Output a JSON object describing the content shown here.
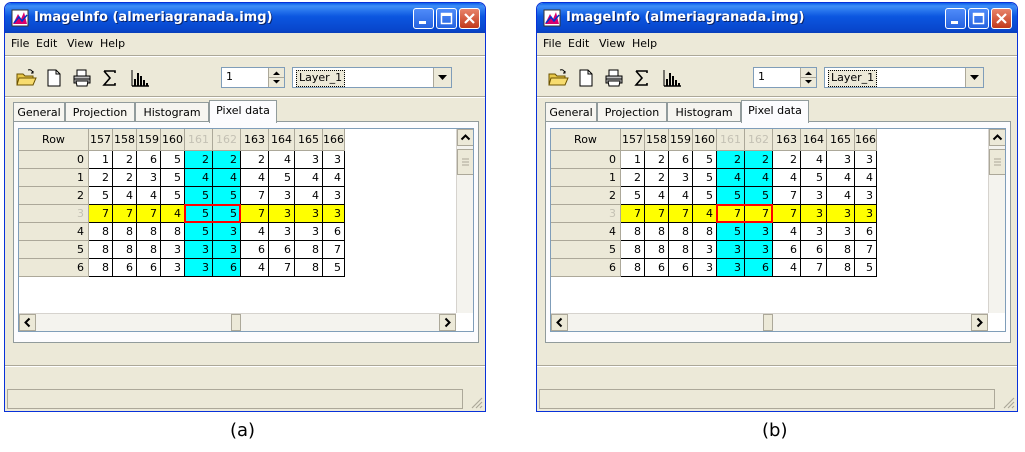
{
  "windows": [
    {
      "title": "ImageInfo (almeriagranada.img)",
      "menu": [
        "File",
        "Edit",
        "View",
        "Help"
      ],
      "spin_value": "1",
      "layer": "Layer_1",
      "tabs": [
        "General",
        "Projection",
        "Histogram",
        "Pixel data"
      ],
      "active_tab": "Pixel data",
      "grid": {
        "row_header": "Row",
        "columns": [
          "157",
          "158",
          "159",
          "160",
          "161",
          "162",
          "163",
          "164",
          "165",
          "166"
        ],
        "rows": [
          {
            "label": "0",
            "cells": [
              "1",
              "2",
              "6",
              "5",
              "2",
              "2",
              "2",
              "4",
              "3",
              "3"
            ]
          },
          {
            "label": "1",
            "cells": [
              "2",
              "2",
              "3",
              "5",
              "4",
              "4",
              "4",
              "5",
              "4",
              "4"
            ]
          },
          {
            "label": "2",
            "cells": [
              "5",
              "4",
              "4",
              "5",
              "5",
              "5",
              "7",
              "3",
              "4",
              "3"
            ]
          },
          {
            "label": "3",
            "cells": [
              "7",
              "7",
              "7",
              "4",
              "5",
              "5",
              "7",
              "3",
              "3",
              "3"
            ]
          },
          {
            "label": "4",
            "cells": [
              "8",
              "8",
              "8",
              "8",
              "5",
              "3",
              "4",
              "3",
              "3",
              "6"
            ]
          },
          {
            "label": "5",
            "cells": [
              "8",
              "8",
              "8",
              "3",
              "3",
              "3",
              "6",
              "6",
              "8",
              "7"
            ]
          },
          {
            "label": "6",
            "cells": [
              "8",
              "6",
              "6",
              "3",
              "3",
              "6",
              "4",
              "7",
              "8",
              "5"
            ]
          }
        ]
      }
    },
    {
      "title": "ImageInfo (almeriagranada.img)",
      "menu": [
        "File",
        "Edit",
        "View",
        "Help"
      ],
      "spin_value": "1",
      "layer": "Layer_1",
      "tabs": [
        "General",
        "Projection",
        "Histogram",
        "Pixel data"
      ],
      "active_tab": "Pixel data",
      "grid": {
        "row_header": "Row",
        "columns": [
          "157",
          "158",
          "159",
          "160",
          "161",
          "162",
          "163",
          "164",
          "165",
          "166"
        ],
        "rows": [
          {
            "label": "0",
            "cells": [
              "1",
              "2",
              "6",
              "5",
              "2",
              "2",
              "2",
              "4",
              "3",
              "3"
            ]
          },
          {
            "label": "1",
            "cells": [
              "2",
              "2",
              "3",
              "5",
              "4",
              "4",
              "4",
              "5",
              "4",
              "4"
            ]
          },
          {
            "label": "2",
            "cells": [
              "5",
              "4",
              "4",
              "5",
              "5",
              "5",
              "7",
              "3",
              "4",
              "3"
            ]
          },
          {
            "label": "3",
            "cells": [
              "7",
              "7",
              "7",
              "4",
              "7",
              "7",
              "7",
              "3",
              "3",
              "3"
            ]
          },
          {
            "label": "4",
            "cells": [
              "8",
              "8",
              "8",
              "8",
              "5",
              "3",
              "4",
              "3",
              "3",
              "6"
            ]
          },
          {
            "label": "5",
            "cells": [
              "8",
              "8",
              "8",
              "3",
              "3",
              "3",
              "6",
              "6",
              "8",
              "7"
            ]
          },
          {
            "label": "6",
            "cells": [
              "8",
              "6",
              "6",
              "3",
              "3",
              "6",
              "4",
              "7",
              "8",
              "5"
            ]
          }
        ]
      }
    }
  ],
  "captions": [
    "(a)",
    "(b)"
  ],
  "highlight": {
    "selected_columns": [
      "161",
      "162"
    ],
    "selected_row": "3",
    "column_color": "#00ffff",
    "row_color": "#ffff00",
    "intersection_border": "#ff0000"
  }
}
